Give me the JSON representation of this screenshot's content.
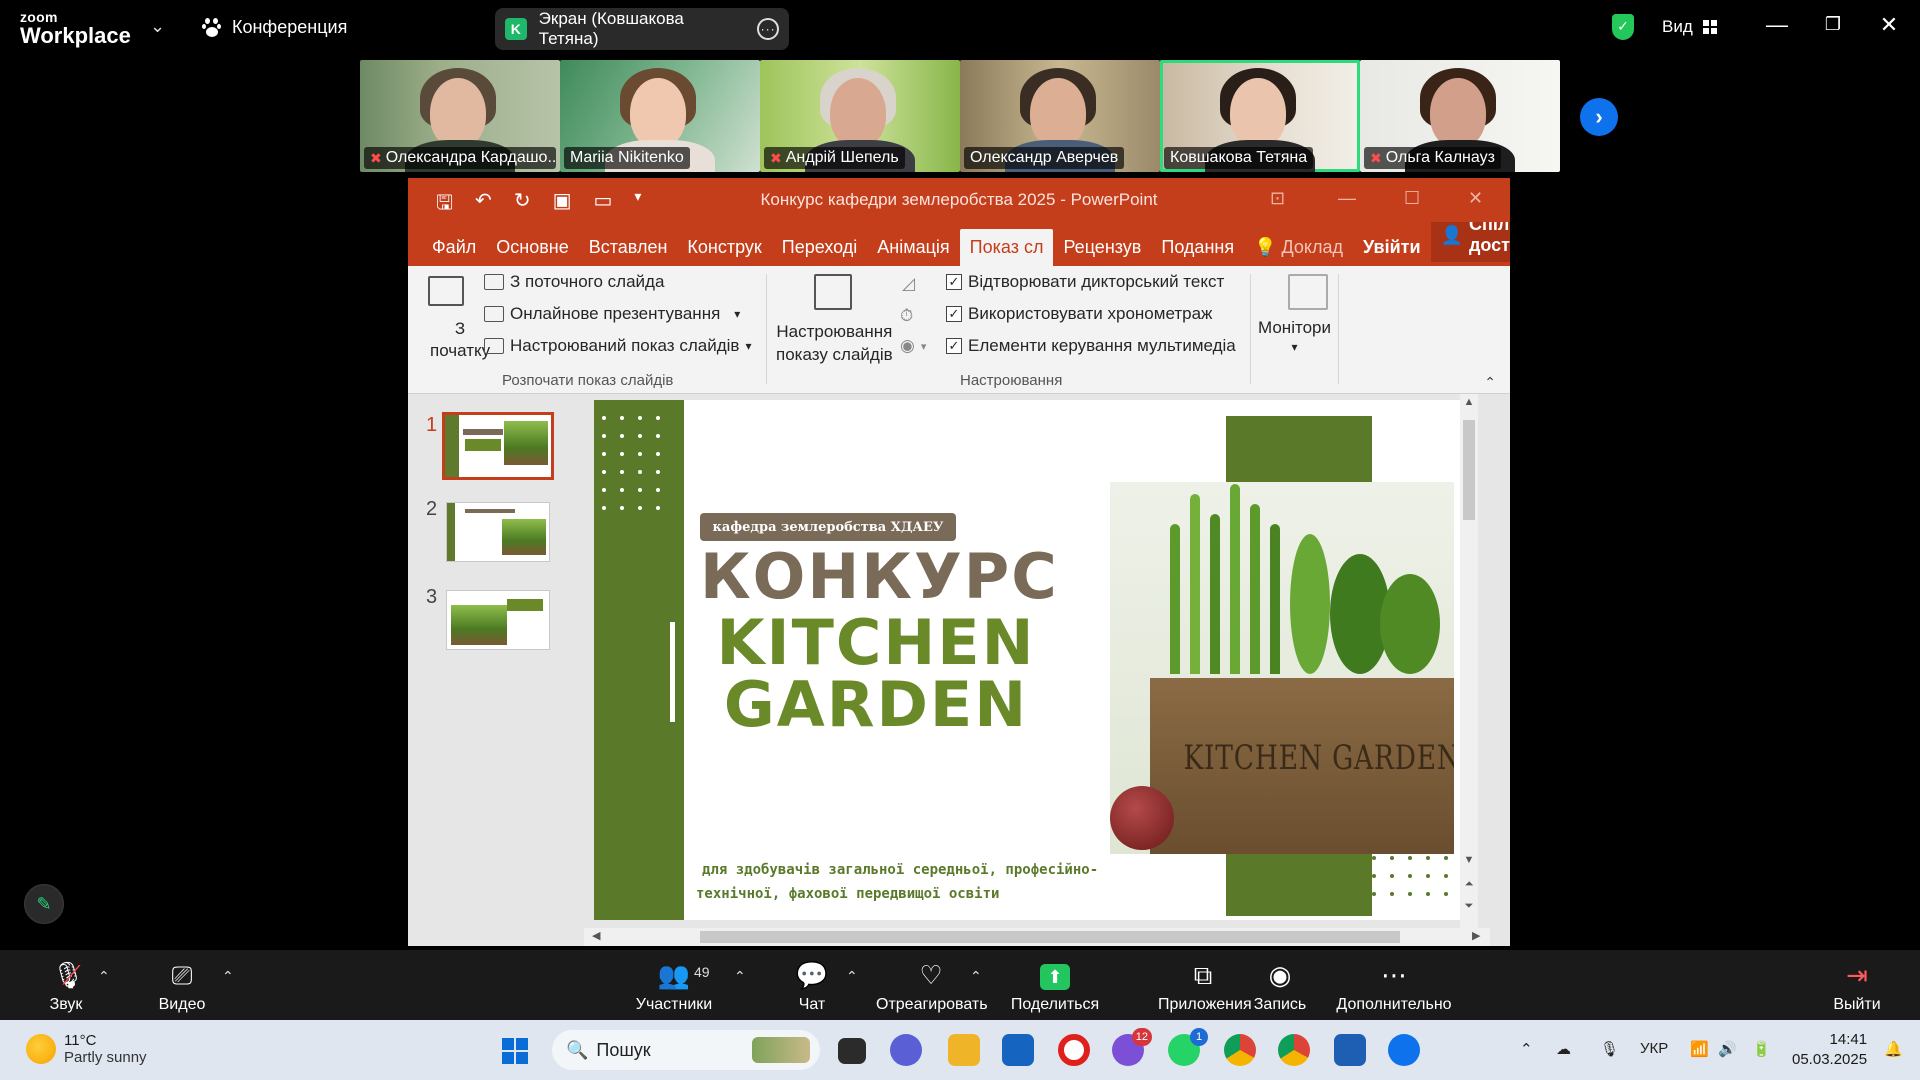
{
  "zoom": {
    "brand_top": "zoom",
    "brand_bottom": "Workplace",
    "meeting_label": "Конференция",
    "share_badge": "K",
    "share_label": "Экран (Ковшакова Тетяна)",
    "view_label": "Вид"
  },
  "participants": [
    {
      "name": "Олександра Кардашо...",
      "muted": true
    },
    {
      "name": "Mariia Nikitenko",
      "muted": false
    },
    {
      "name": "Андрій Шепель",
      "muted": true
    },
    {
      "name": "Олександр Аверчев",
      "muted": false
    },
    {
      "name": "Ковшакова Тетяна",
      "muted": false,
      "active": true
    },
    {
      "name": "Ольга Калнауз",
      "muted": true
    }
  ],
  "ppt": {
    "title": "Конкурс кафедри землеробства 2025 - PowerPoint",
    "tabs": [
      "Файл",
      "Основне",
      "Вставлен",
      "Конструк",
      "Переході",
      "Анімація",
      "Показ сл",
      "Рецензув",
      "Подання",
      "Доклад",
      "Увійти"
    ],
    "share": "Спільний доступ",
    "ribbon": {
      "from_start_1": "З",
      "from_start_2": "початку",
      "from_current": "З поточного слайда",
      "online": "Онлайнове презентування",
      "custom_show": "Настроюваний показ слайдів",
      "group_start": "Розпочати показ слайдів",
      "setup_1": "Настроювання",
      "setup_2": "показу слайдів",
      "narration": "Відтворювати дикторський текст",
      "timings": "Використовувати хронометраж",
      "media": "Елементи керування мультимедіа",
      "group_setup": "Настроювання",
      "monitors": "Монітори"
    },
    "thumbnails": [
      "1",
      "2",
      "3"
    ],
    "slide": {
      "pill": "кафедра землеробства ХДАЕУ",
      "title": "КОНКУРС",
      "kg_line1": "KITCHEN",
      "kg_line2": "GARDEN",
      "subtitle_1": "для здобувачів загальної середньої, професійно-",
      "subtitle_2": "технічної, фахової передвищої освіти",
      "box_text": "KITCHEN GARDEN"
    }
  },
  "toolbar": {
    "audio": "Звук",
    "video": "Видео",
    "participants": "Участники",
    "participants_count": "49",
    "chat": "Чат",
    "react": "Отреагировать",
    "share": "Поделиться",
    "apps": "Приложения",
    "record": "Запись",
    "more": "Дополнительно",
    "leave": "Выйти"
  },
  "taskbar": {
    "temp": "11°C",
    "weather": "Partly sunny",
    "search": "Пошук",
    "lang": "УКР",
    "time": "14:41",
    "date": "05.03.2025",
    "viber_badge": "12",
    "whatsapp_badge": "1"
  }
}
